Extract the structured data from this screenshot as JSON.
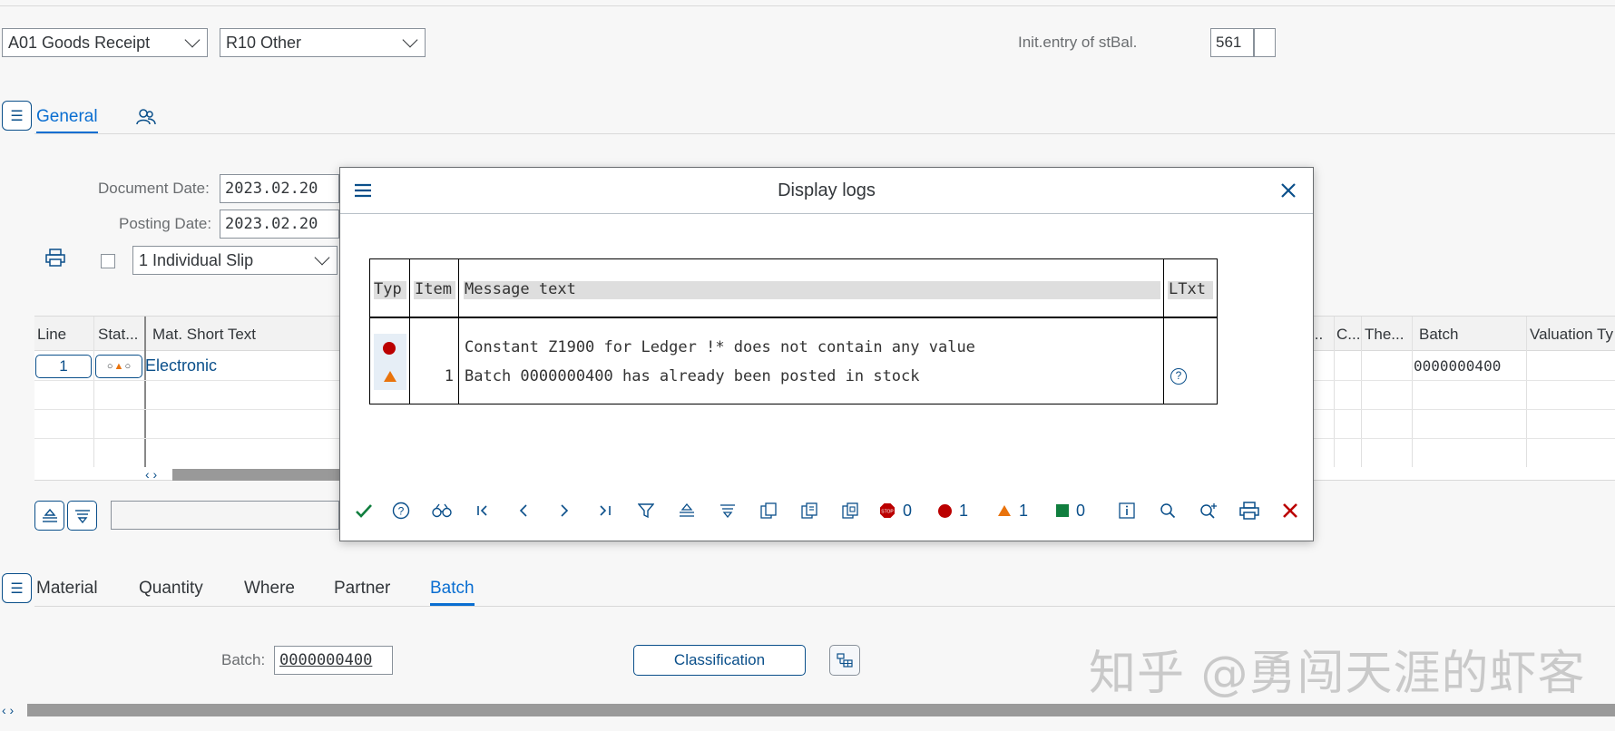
{
  "header": {
    "movement_type": "A01 Goods Receipt",
    "reference": "R10 Other",
    "movement_label": "Init.entry of stBal.",
    "movement_code": "561"
  },
  "tabs_top": [
    {
      "label": "General"
    }
  ],
  "general": {
    "document_date_label": "Document Date:",
    "document_date": "2023.02.20",
    "posting_date_label": "Posting Date:",
    "posting_date": "2023.02.20",
    "print_option": "1 Individual Slip"
  },
  "items_table": {
    "columns": [
      "Line",
      "Stat...",
      "Mat. Short Text",
      "...",
      "C...",
      "The...",
      "Batch",
      "Valuation Ty"
    ],
    "rows": [
      {
        "line": "1",
        "mat_short_text": "Electronic",
        "batch": "0000000400"
      }
    ]
  },
  "dialog": {
    "title": "Display logs",
    "table": {
      "headers": [
        "Typ",
        "Item",
        "Message text",
        "LTxt"
      ],
      "rows": [
        {
          "type": "error",
          "item": "",
          "text": "Constant Z1900 for Ledger !* does not contain any value"
        },
        {
          "type": "warning",
          "item": "1",
          "text": "Batch 0000000400 has already been posted in stock"
        }
      ]
    },
    "counts": {
      "stop": "0",
      "error": "1",
      "warning": "1",
      "success": "0"
    },
    "colors": {
      "error": "#bb0000",
      "warning": "#e9730c",
      "success": "#107e3e",
      "accept": "#107e3e"
    }
  },
  "detail_tabs": [
    {
      "label": "Material"
    },
    {
      "label": "Quantity"
    },
    {
      "label": "Where"
    },
    {
      "label": "Partner"
    },
    {
      "label": "Batch"
    }
  ],
  "batch_section": {
    "batch_label": "Batch:",
    "batch_value": "0000000400",
    "classification_button": "Classification"
  },
  "watermark": "知乎 @勇闯天涯的虾客"
}
